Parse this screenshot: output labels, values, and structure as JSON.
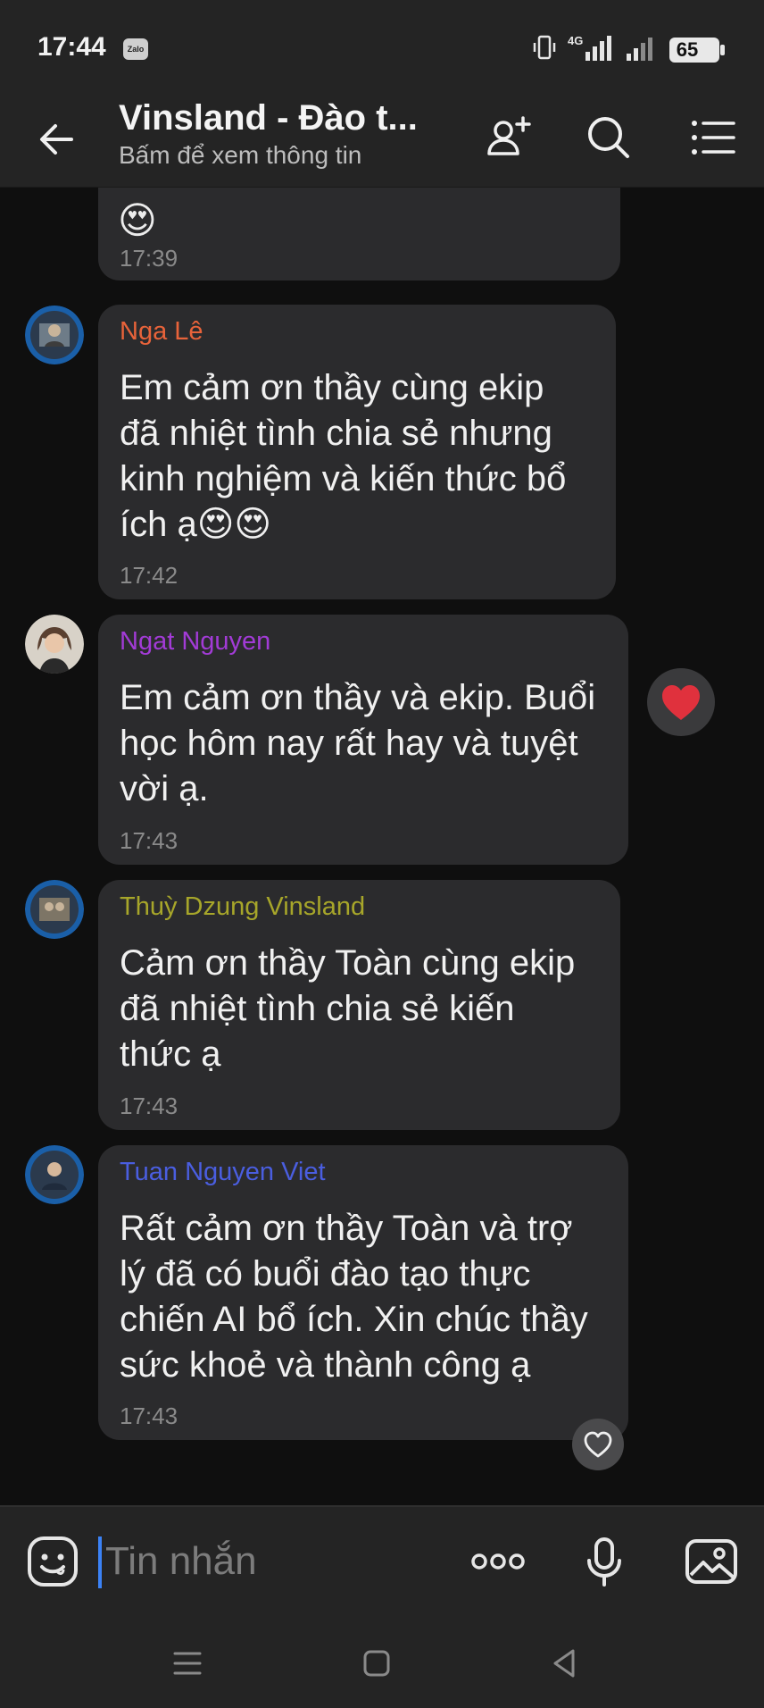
{
  "status_bar": {
    "time": "17:44",
    "notification_icon": "zalo-icon",
    "notification_label": "Zalo",
    "battery": "65"
  },
  "header": {
    "title": "Vinsland - Đào t...",
    "subtitle": "Bấm để xem thông tin"
  },
  "messages": [
    {
      "sender": "",
      "text": "",
      "time": "17:39"
    },
    {
      "sender": "Nga Lê",
      "sender_color": "#e8633a",
      "text": "Em cảm ơn thầy cùng ekip\nđã nhiệt tình chia sẻ nhưng\nkinh nghiệm và kiến thức bổ\ních ạ😍😍",
      "time": "17:42"
    },
    {
      "sender": "Ngat Nguyen",
      "sender_color": "#a23bd6",
      "text": "Em cảm ơn thầy và ekip. Buổi\nhọc hôm nay rất hay và tuyệt\nvời ạ.",
      "time": "17:43",
      "reaction": "heart-filled"
    },
    {
      "sender": "Thuỳ Dzung Vinsland",
      "sender_color": "#a7a62a",
      "text": "Cảm ơn thầy Toàn cùng ekip\nđã nhiệt tình chia sẻ kiến\nthức ạ",
      "time": "17:43"
    },
    {
      "sender": "Tuan Nguyen Viet",
      "sender_color": "#4a5ee0",
      "text": "Rất cảm ơn thầy Toàn và trợ\nlý đã có buổi đào tạo thực\nchiến AI bổ ích. Xin chúc thầy\nsức khoẻ và thành công ạ",
      "time": "17:43",
      "reaction": "heart-outline"
    }
  ],
  "first_message_emoji": "😍",
  "composer": {
    "placeholder": "Tin nhắn"
  },
  "colors": {
    "bar_bg": "#242424",
    "chat_bg": "#0f0f0f",
    "bubble_bg": "#2b2b2d",
    "accent": "#3b82f6",
    "heart": "#e0313d"
  }
}
